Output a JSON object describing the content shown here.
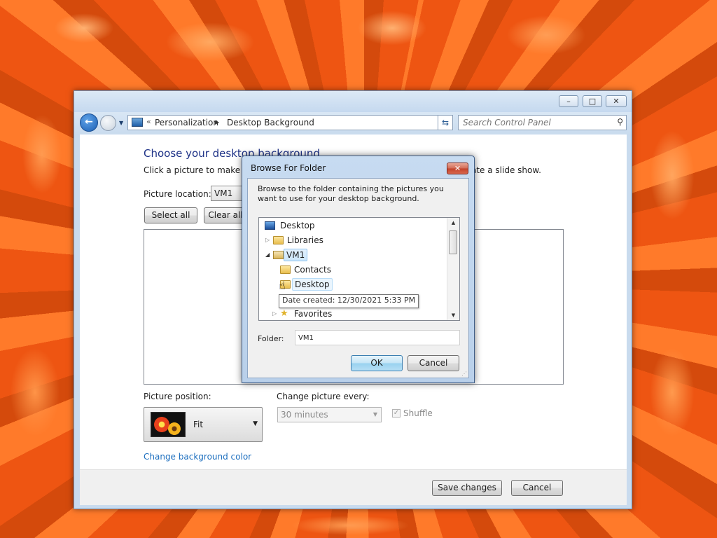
{
  "window": {
    "breadcrumbs_overflow": "«",
    "breadcrumbs": [
      "Personalization",
      "Desktop Background"
    ],
    "search_placeholder": "Search Control Panel",
    "caption_min": "▭",
    "caption_max": "□",
    "caption_close": "✕"
  },
  "content": {
    "title": "Choose your desktop background",
    "description_head": "Click a picture to make it y",
    "description_tail": "ate a slide show.",
    "picture_location_label": "Picture location:",
    "picture_location_value": "VM1",
    "select_all_label": "Select all",
    "clear_all_label": "Clear all",
    "picture_position_label": "Picture position:",
    "picture_position_value": "Fit",
    "change_picture_label": "Change picture every:",
    "change_picture_value": "30 minutes",
    "shuffle_label": "Shuffle",
    "shuffle_checked": true,
    "change_color_link": "Change background color"
  },
  "footer": {
    "save_label": "Save changes",
    "cancel_label": "Cancel"
  },
  "dialog": {
    "title": "Browse For Folder",
    "instructions": "Browse to the folder containing the pictures you want to use for your desktop background.",
    "tree": {
      "desktop_root": "Desktop",
      "libraries": "Libraries",
      "vm1": "VM1",
      "contacts": "Contacts",
      "desktop_child": "Desktop",
      "favorites": "Favorites"
    },
    "tooltip": "Date created: 12/30/2021 5:33 PM",
    "folder_label": "Folder:",
    "folder_value": "VM1",
    "ok_label": "OK",
    "cancel_label": "Cancel"
  },
  "colors": {
    "title_blue": "#1e3287",
    "link_blue": "#1d6fbf",
    "wallpaper_orange": "#e8551a"
  }
}
